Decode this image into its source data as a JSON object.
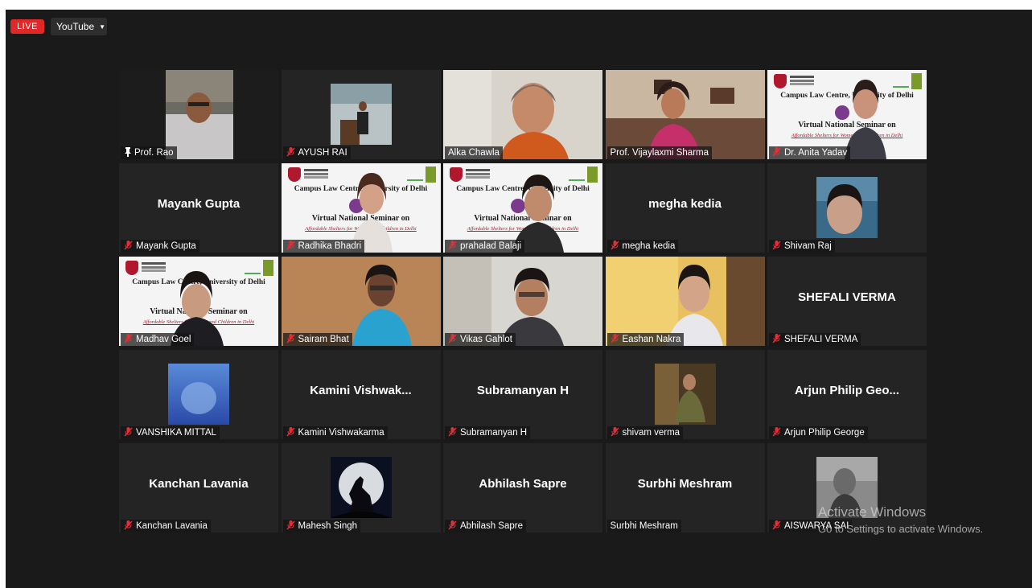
{
  "toolbar": {
    "live_label": "LIVE",
    "stream_target": "YouTube"
  },
  "tiles": [
    {
      "name": "Prof. Rao",
      "big": "",
      "muted": false,
      "pinned": true,
      "video": true,
      "active": true
    },
    {
      "name": "AYUSH RAI",
      "big": "",
      "muted": true,
      "video": true
    },
    {
      "name": "Alka Chawla",
      "big": "",
      "muted": false,
      "video": true
    },
    {
      "name": "Prof. Vijaylaxmi Sharma",
      "big": "",
      "muted": false,
      "video": true
    },
    {
      "name": "Dr. Anita Yadav",
      "big": "",
      "muted": true,
      "video": true
    },
    {
      "name": "Mayank Gupta",
      "big": "Mayank Gupta",
      "muted": true,
      "video": false
    },
    {
      "name": "Radhika Bhadri",
      "big": "",
      "muted": true,
      "video": true
    },
    {
      "name": "prahalad Balaji",
      "big": "",
      "muted": true,
      "video": true
    },
    {
      "name": "megha kedia",
      "big": "megha kedia",
      "muted": true,
      "video": false
    },
    {
      "name": "Shivam Raj",
      "big": "",
      "muted": true,
      "video": true
    },
    {
      "name": "Madhav Goel",
      "big": "",
      "muted": true,
      "video": true
    },
    {
      "name": "Sairam Bhat",
      "big": "",
      "muted": true,
      "video": true
    },
    {
      "name": "Vikas Gahlot",
      "big": "",
      "muted": true,
      "video": true
    },
    {
      "name": "Eashan Nakra",
      "big": "",
      "muted": true,
      "video": true
    },
    {
      "name": "SHEFALI VERMA",
      "big": "SHEFALI VERMA",
      "muted": true,
      "video": false
    },
    {
      "name": "VANSHIKA MITTAL",
      "big": "",
      "muted": true,
      "video": true
    },
    {
      "name": "Kamini Vishwakarma",
      "big": "Kamini  Vishwak...",
      "muted": true,
      "video": false
    },
    {
      "name": "Subramanyan H",
      "big": "Subramanyan H",
      "muted": true,
      "video": false
    },
    {
      "name": "shivam verma",
      "big": "",
      "muted": true,
      "video": true
    },
    {
      "name": "Arjun Philip George",
      "big": "Arjun  Philip Geo...",
      "muted": true,
      "video": false
    },
    {
      "name": "Kanchan Lavania",
      "big": "Kanchan Lavania",
      "muted": true,
      "video": false
    },
    {
      "name": "Mahesh Singh",
      "big": "",
      "muted": true,
      "video": true
    },
    {
      "name": "Abhilash Sapre",
      "big": "Abhilash Sapre",
      "muted": true,
      "video": false
    },
    {
      "name": "Surbhi Meshram",
      "big": "Surbhi Meshram",
      "muted": false,
      "video": false
    },
    {
      "name": "AISWARYA SAI",
      "big": "",
      "muted": true,
      "video": true
    }
  ],
  "banner": {
    "title": "Campus Law Centre, University of Delhi",
    "event": "Virtual National Seminar on",
    "subtitle": "Affordable Shelters for Women and Children in Delhi"
  },
  "watermark": {
    "line1": "Activate Windows",
    "line2": "Go to Settings to activate Windows."
  },
  "colors": {
    "active_border": "#d7e85a",
    "live_red": "#e02828",
    "muted_red": "#e0303a"
  }
}
